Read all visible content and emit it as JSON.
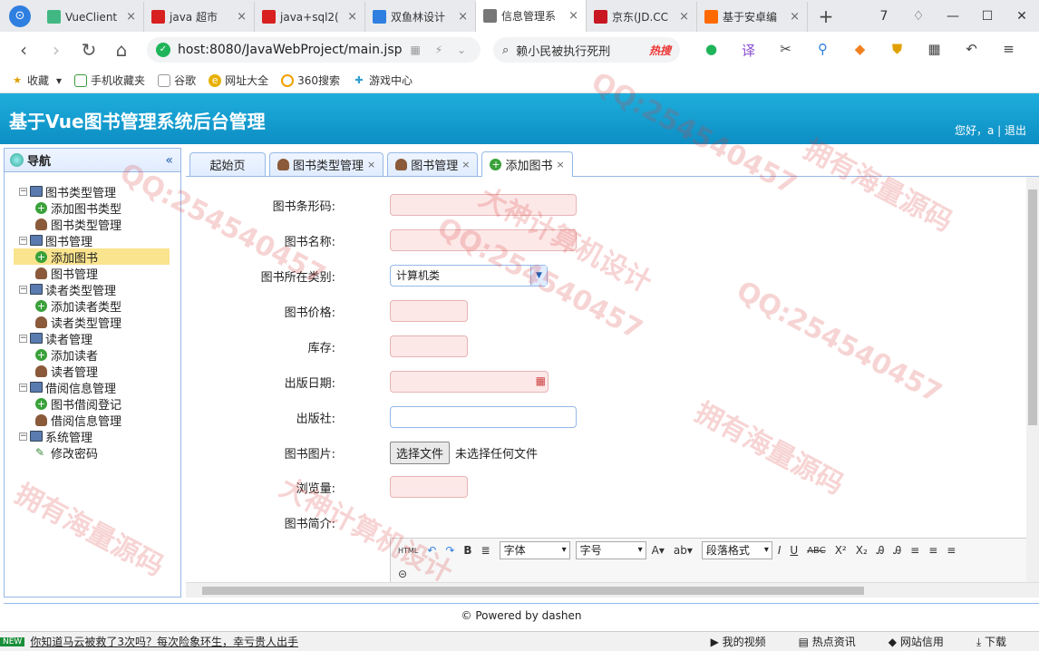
{
  "browser": {
    "tabs": [
      {
        "label": "VueClient",
        "color": "#41b883"
      },
      {
        "label": "java 超市",
        "color": "#d82020"
      },
      {
        "label": "java+sql2(",
        "color": "#d82020"
      },
      {
        "label": "双鱼林设计",
        "color": "#2f7fe0"
      },
      {
        "label": "信息管理系",
        "color": "#777777",
        "active": true
      },
      {
        "label": "京东(JD.CC",
        "color": "#c81623"
      },
      {
        "label": "基于安卓编",
        "color": "#ff6a00"
      }
    ],
    "url": "host:8080/JavaWebProject/main.jsp",
    "search_text": "赖小民被执行死刑",
    "search_hot": "热搜",
    "bookmarks": [
      "收藏",
      "手机收藏夹",
      "谷歌",
      "网址大全",
      "360搜索",
      "游戏中心"
    ],
    "window_controls": {
      "tab_count": "7"
    }
  },
  "app": {
    "title": "基于Vue图书管理系统后台管理",
    "user_info": "您好，a | 退出",
    "nav_title": "导航",
    "nav_collapse": "«",
    "tree": [
      {
        "label": "图书类型管理",
        "level": 1,
        "icon": "monitor-icon"
      },
      {
        "label": "添加图书类型",
        "level": 2,
        "icon": "add-icon"
      },
      {
        "label": "图书类型管理",
        "level": 2,
        "icon": "user-icon"
      },
      {
        "label": "图书管理",
        "level": 1,
        "icon": "monitor-icon"
      },
      {
        "label": "添加图书",
        "level": 2,
        "icon": "add-icon",
        "selected": true
      },
      {
        "label": "图书管理",
        "level": 2,
        "icon": "user-icon"
      },
      {
        "label": "读者类型管理",
        "level": 1,
        "icon": "monitor-icon"
      },
      {
        "label": "添加读者类型",
        "level": 2,
        "icon": "add-icon"
      },
      {
        "label": "读者类型管理",
        "level": 2,
        "icon": "user-icon"
      },
      {
        "label": "读者管理",
        "level": 1,
        "icon": "monitor-icon"
      },
      {
        "label": "添加读者",
        "level": 2,
        "icon": "add-icon"
      },
      {
        "label": "读者管理",
        "level": 2,
        "icon": "user-icon"
      },
      {
        "label": "借阅信息管理",
        "level": 1,
        "icon": "monitor-icon"
      },
      {
        "label": "图书借阅登记",
        "level": 2,
        "icon": "add-icon"
      },
      {
        "label": "借阅信息管理",
        "level": 2,
        "icon": "user-icon"
      },
      {
        "label": "系统管理",
        "level": 1,
        "icon": "monitor-icon"
      },
      {
        "label": "修改密码",
        "level": 2,
        "icon": "pen-icon"
      }
    ],
    "tabs": [
      {
        "label": "起始页"
      },
      {
        "label": "图书类型管理",
        "closable": true
      },
      {
        "label": "图书管理",
        "closable": true
      },
      {
        "label": "添加图书",
        "closable": true,
        "active": true
      }
    ],
    "form": {
      "barcode_label": "图书条形码:",
      "name_label": "图书名称:",
      "category_label": "图书所在类别:",
      "category_value": "计算机类",
      "price_label": "图书价格:",
      "stock_label": "库存:",
      "date_label": "出版日期:",
      "publisher_label": "出版社:",
      "image_label": "图书图片:",
      "file_button": "选择文件",
      "file_status": "未选择任何文件",
      "views_label": "浏览量:",
      "intro_label": "图书简介:",
      "editor_font": "字体",
      "editor_size": "字号",
      "editor_paragraph": "段落格式"
    },
    "footer": "© Powered by dashen"
  },
  "statusbar": {
    "badge": "NEW",
    "message": "你知道马云被救了3次吗？每次险象环生，幸亏贵人出手",
    "items": [
      "我的视频",
      "热点资讯",
      "网站信用",
      "下载"
    ]
  },
  "watermark": {
    "texts": [
      "QQ:254540457",
      "拥有海量源码",
      "大神计算机设计"
    ]
  }
}
